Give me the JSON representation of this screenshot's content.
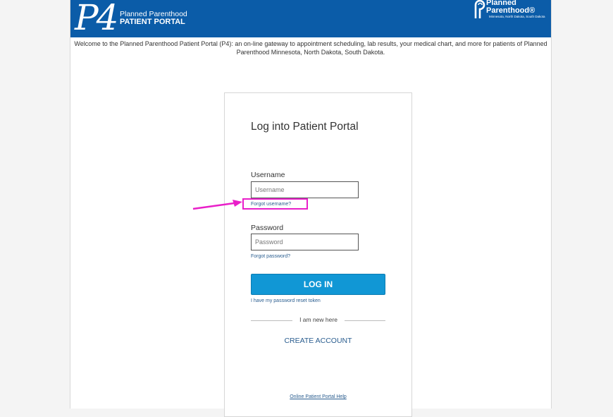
{
  "header": {
    "logo_text": "P4",
    "brand_line1": "Planned Parenthood",
    "brand_line2": "PATIENT PORTAL",
    "org_name_line1": "Planned",
    "org_name_line2": "Parenthood®",
    "org_region": "Minnesota, North Dakota, South Dakota",
    "color": "#0b5ca8"
  },
  "welcome_text": "Welcome to the Planned Parenthood Patient Portal (P4): an on-line gateway to appointment scheduling, lab results, your medical chart, and more for patients of Planned Parenthood Minnesota, North Dakota, South Dakota.",
  "login": {
    "title": "Log into Patient Portal",
    "username_label": "Username",
    "username_placeholder": "Username",
    "forgot_username": "Forgot username?",
    "password_label": "Password",
    "password_placeholder": "Password",
    "forgot_password": "Forgot password?",
    "login_button": "LOG IN",
    "reset_token_link": "I have my password reset token",
    "new_here": "I am new here",
    "create_account": "CREATE ACCOUNT",
    "help_link": "Online Patient Portal Help",
    "button_color": "#1197d5",
    "annotation_color": "#e91fc9"
  }
}
